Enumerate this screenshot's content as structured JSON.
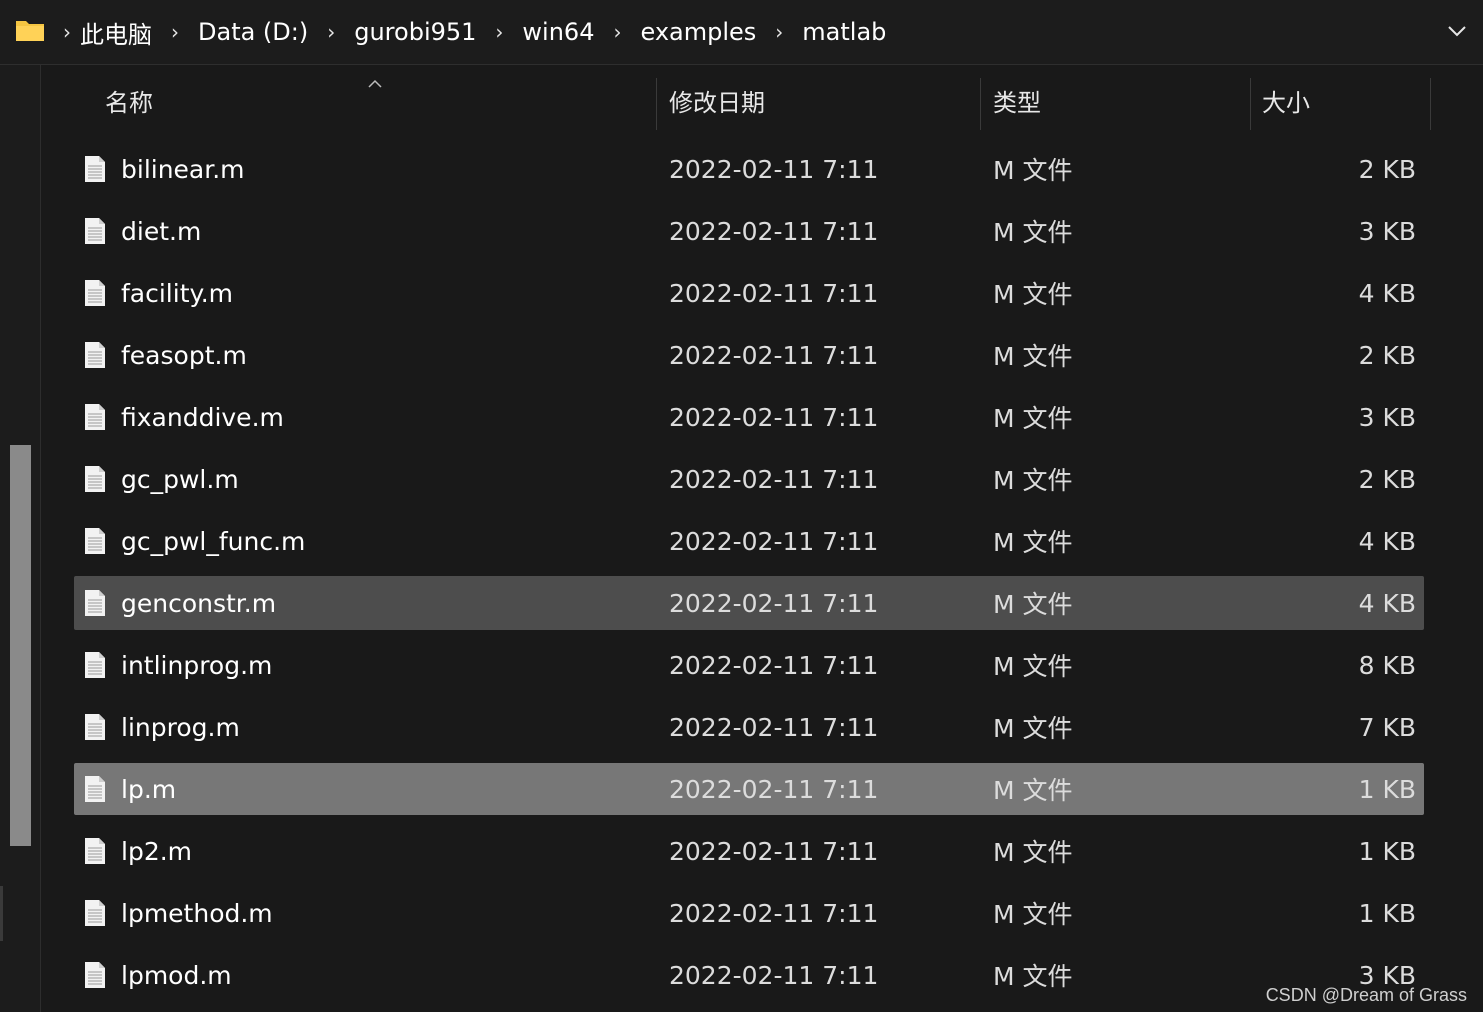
{
  "breadcrumb": [
    "此电脑",
    "Data (D:)",
    "gurobi951",
    "win64",
    "examples",
    "matlab"
  ],
  "icons": {
    "folder": "folder-icon",
    "file": "document-icon",
    "separator": "chevron-right-icon",
    "dropdown": "chevron-down-icon",
    "sort": "chevron-up-icon"
  },
  "columns": {
    "name": "名称",
    "date": "修改日期",
    "type": "类型",
    "size": "大小"
  },
  "files": [
    {
      "name": "bilinear.m",
      "date": "2022-02-11 7:11",
      "type": "M 文件",
      "size": "2 KB"
    },
    {
      "name": "diet.m",
      "date": "2022-02-11 7:11",
      "type": "M 文件",
      "size": "3 KB"
    },
    {
      "name": "facility.m",
      "date": "2022-02-11 7:11",
      "type": "M 文件",
      "size": "4 KB"
    },
    {
      "name": "feasopt.m",
      "date": "2022-02-11 7:11",
      "type": "M 文件",
      "size": "2 KB"
    },
    {
      "name": "fixanddive.m",
      "date": "2022-02-11 7:11",
      "type": "M 文件",
      "size": "3 KB"
    },
    {
      "name": "gc_pwl.m",
      "date": "2022-02-11 7:11",
      "type": "M 文件",
      "size": "2 KB"
    },
    {
      "name": "gc_pwl_func.m",
      "date": "2022-02-11 7:11",
      "type": "M 文件",
      "size": "4 KB"
    },
    {
      "name": "genconstr.m",
      "date": "2022-02-11 7:11",
      "type": "M 文件",
      "size": "4 KB",
      "state": "hover"
    },
    {
      "name": "intlinprog.m",
      "date": "2022-02-11 7:11",
      "type": "M 文件",
      "size": "8 KB"
    },
    {
      "name": "linprog.m",
      "date": "2022-02-11 7:11",
      "type": "M 文件",
      "size": "7 KB"
    },
    {
      "name": "lp.m",
      "date": "2022-02-11 7:11",
      "type": "M 文件",
      "size": "1 KB",
      "state": "selected"
    },
    {
      "name": "lp2.m",
      "date": "2022-02-11 7:11",
      "type": "M 文件",
      "size": "1 KB"
    },
    {
      "name": "lpmethod.m",
      "date": "2022-02-11 7:11",
      "type": "M 文件",
      "size": "1 KB"
    },
    {
      "name": "lpmod.m",
      "date": "2022-02-11 7:11",
      "type": "M 文件",
      "size": "3 KB"
    }
  ],
  "watermark": "CSDN @Dream of Grass",
  "colors": {
    "background": "#191919",
    "hover": "#4d4d4d",
    "selected": "#777777",
    "folder": "#f5c542"
  }
}
